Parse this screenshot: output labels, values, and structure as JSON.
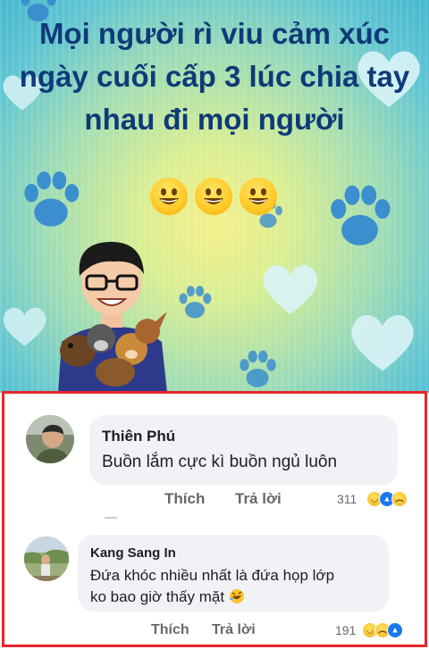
{
  "post": {
    "title": "Mọi người rì viu cảm xúc ngày cuối cấp 3 lúc chia tay nhau đi mọi người",
    "emoji_count": 3,
    "emoji": "grinning-face"
  },
  "comments": [
    {
      "author": "Thiên Phú",
      "text_lines": [
        "Buồn lắm cực kì buồn ngủ luôn"
      ],
      "like_label": "Thích",
      "reply_label": "Trả lời",
      "reaction_count": "311",
      "reactions": [
        "haha",
        "like",
        "sad"
      ]
    },
    {
      "author": "Kang Sang In",
      "text_lines": [
        "Đứa khóc nhiều nhất là đứa họp lớp",
        "ko bao giờ thấy mặt"
      ],
      "text_emoji": "rolling-on-floor-laughing",
      "like_label": "Thích",
      "reply_label": "Trả lời",
      "reaction_count": "191",
      "reactions": [
        "haha",
        "sad",
        "like"
      ]
    }
  ],
  "colors": {
    "title": "#0f3a78",
    "highlight_border": "#e5262a",
    "bubble": "#f0f2f5",
    "secondary_text": "#65676b"
  }
}
